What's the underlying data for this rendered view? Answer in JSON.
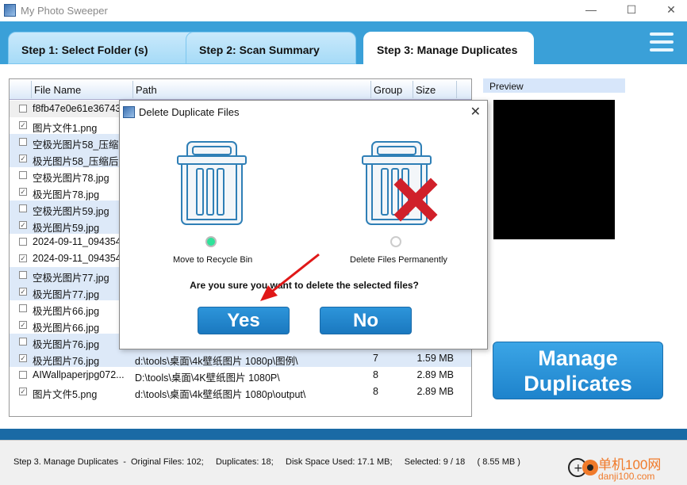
{
  "window": {
    "title": "My Photo Sweeper",
    "minimize": "—",
    "maximize": "☐",
    "close": "✕"
  },
  "tabs": [
    {
      "label": "Step 1: Select Folder (s)"
    },
    {
      "label": "Step 2: Scan Summary"
    },
    {
      "label": "Step 3: Manage Duplicates",
      "active": true
    }
  ],
  "columns": {
    "filename": "File Name",
    "path": "Path",
    "group": "Group",
    "size": "Size"
  },
  "rows": [
    {
      "checked": false,
      "name": "f8fb47e0e61e36743",
      "path": "",
      "group": "",
      "size": ""
    },
    {
      "checked": true,
      "name": "图片文件1.png",
      "path": "",
      "group": "",
      "size": ""
    },
    {
      "checked": false,
      "name": "空极光图片58_压缩后",
      "path": "",
      "group": "",
      "size": ""
    },
    {
      "checked": true,
      "name": "极光图片58_压缩后.j",
      "path": "",
      "group": "",
      "size": ""
    },
    {
      "checked": false,
      "name": "空极光图片78.jpg",
      "path": "",
      "group": "",
      "size": ""
    },
    {
      "checked": true,
      "name": "极光图片78.jpg",
      "path": "",
      "group": "",
      "size": ""
    },
    {
      "checked": false,
      "name": "空极光图片59.jpg",
      "path": "",
      "group": "",
      "size": ""
    },
    {
      "checked": true,
      "name": "极光图片59.jpg",
      "path": "",
      "group": "",
      "size": ""
    },
    {
      "checked": false,
      "name": "2024-09-11_094354",
      "path": "",
      "group": "",
      "size": ""
    },
    {
      "checked": true,
      "name": "2024-09-11_094354",
      "path": "",
      "group": "",
      "size": ""
    },
    {
      "checked": false,
      "name": "空极光图片77.jpg",
      "path": "",
      "group": "",
      "size": ""
    },
    {
      "checked": true,
      "name": "极光图片77.jpg",
      "path": "",
      "group": "",
      "size": ""
    },
    {
      "checked": false,
      "name": "极光图片66.jpg",
      "path": "",
      "group": "",
      "size": ""
    },
    {
      "checked": true,
      "name": "极光图片66.jpg",
      "path": "",
      "group": "",
      "size": ""
    },
    {
      "checked": false,
      "name": "极光图片76.jpg",
      "path": "",
      "group": "",
      "size": ""
    },
    {
      "checked": true,
      "name": "极光图片76.jpg",
      "path": "d:\\tools\\桌面\\4k壁纸图片 1080p\\图例\\",
      "group": "7",
      "size": "1.59 MB"
    },
    {
      "checked": false,
      "name": "AIWallpaperjpg072...",
      "path": "D:\\tools\\桌面\\4K壁纸图片 1080P\\",
      "group": "8",
      "size": "2.89 MB"
    },
    {
      "checked": true,
      "name": "图片文件5.png",
      "path": "d:\\tools\\桌面\\4k壁纸图片 1080p\\output\\",
      "group": "8",
      "size": "2.89 MB"
    }
  ],
  "preview": {
    "label": "Preview"
  },
  "manage_button": {
    "line1": "Manage",
    "line2": "Duplicates"
  },
  "status": "Step 3. Manage Duplicates  -  Original Files: 102;     Duplicates: 18;     Disk Space Used: 17.1 MB;     Selected: 9 / 18     ( 8.55 MB )",
  "watermark": {
    "line1": "单机100网",
    "line2": "danji100.com"
  },
  "dialog": {
    "title": "Delete Duplicate Files",
    "close": "✕",
    "option1": "Move to Recycle Bin",
    "option2": "Delete Files Permanently",
    "selected_option": "Move to Recycle Bin",
    "question": "Are you sure you want to delete the selected files?",
    "yes": "Yes",
    "no": "No"
  },
  "colors": {
    "accent": "#3aa0d8",
    "button": "#1e83cc",
    "selected_radio": "#2ee39a",
    "delete_x": "#d0202a"
  }
}
